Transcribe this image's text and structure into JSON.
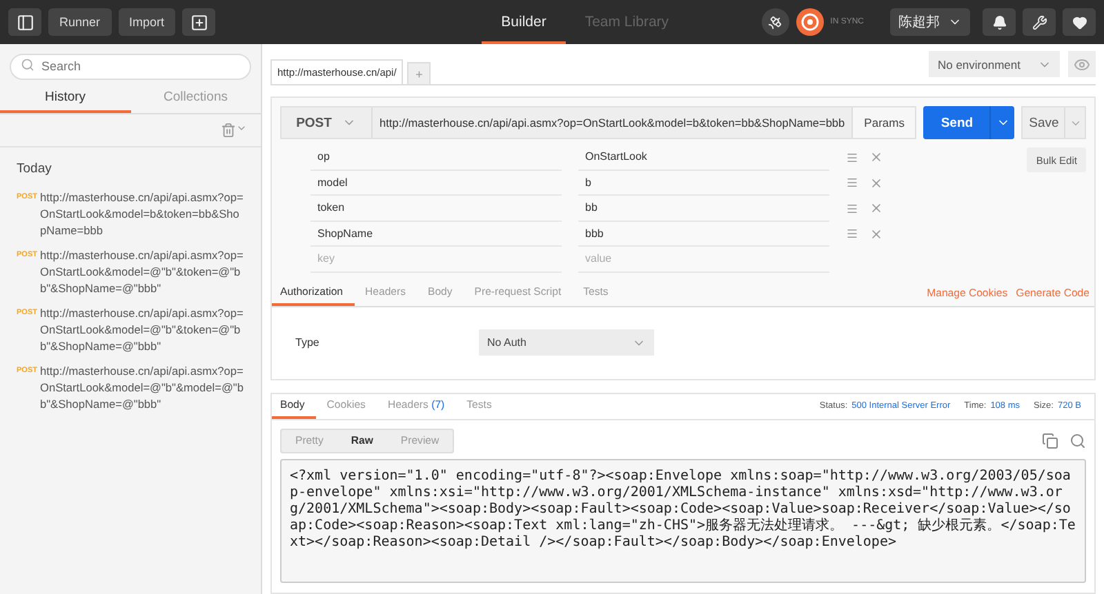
{
  "toolbar": {
    "buttons": [
      "Runner",
      "Import"
    ],
    "tabs": [
      {
        "label": "Builder",
        "selected": true
      },
      {
        "label": "Team Library",
        "selected": false
      }
    ],
    "sync": "IN SYNC",
    "user": "陈超邦"
  },
  "sidebar": {
    "search": {
      "placeholder": "Search"
    },
    "tabs": [
      {
        "label": "History",
        "selected": true
      },
      {
        "label": "Collections",
        "selected": false
      }
    ],
    "group": "Today",
    "items": [
      {
        "method": "POST",
        "url": "http://masterhouse.cn/api/api.asmx?op=OnStartLook&model=b&token=bb&ShopName=bbb"
      },
      {
        "method": "POST",
        "url": "http://masterhouse.cn/api/api.asmx?op=OnStartLook&model=@\"b\"&token=@\"bb\"&ShopName=@\"bbb\""
      },
      {
        "method": "POST",
        "url": "http://masterhouse.cn/api/api.asmx?op=OnStartLook&model=@\"b\"&token=@\"bb\"&ShopName=@\"bbb\""
      },
      {
        "method": "POST",
        "url": "http://masterhouse.cn/api/api.asmx?op=OnStartLook&model=@\"b\"&model=@\"bb\"&ShopName=@\"bbb\""
      }
    ]
  },
  "request_tabs": [
    {
      "label": "http://masterhouse.cn/api/",
      "selected": true
    }
  ],
  "new_tab": "+",
  "environment": "No environment",
  "request": {
    "method": "POST",
    "url": "http://masterhouse.cn/api/api.asmx?op=OnStartLook&model=b&token=bb&ShopName=bbb",
    "params_button": "Params",
    "send": "Send",
    "save": "Save",
    "params": [
      {
        "key": "op",
        "value": "OnStartLook"
      },
      {
        "key": "model",
        "value": "b"
      },
      {
        "key": "token",
        "value": "bb"
      },
      {
        "key": "ShopName",
        "value": "bbb"
      }
    ],
    "key_placeholder": "key",
    "value_placeholder": "value",
    "bulk_edit": "Bulk Edit",
    "tabs": [
      {
        "label": "Authorization",
        "selected": true
      },
      {
        "label": "Headers",
        "selected": false
      },
      {
        "label": "Body",
        "selected": false
      },
      {
        "label": "Pre-request Script",
        "selected": false
      },
      {
        "label": "Tests",
        "selected": false
      }
    ],
    "links": [
      "Manage Cookies",
      "Generate Code"
    ],
    "auth": {
      "label": "Type",
      "value": "No Auth"
    }
  },
  "response": {
    "tabs": [
      {
        "label": "Body",
        "selected": true
      },
      {
        "label": "Cookies",
        "selected": false
      },
      {
        "label": "Headers",
        "count": "(7)",
        "selected": false
      },
      {
        "label": "Tests",
        "selected": false
      }
    ],
    "stats": [
      {
        "label": "Status:",
        "value": "500 Internal Server Error"
      },
      {
        "label": "Time:",
        "value": "108 ms"
      },
      {
        "label": "Size:",
        "value": "720 B"
      }
    ],
    "views": [
      {
        "label": "Pretty",
        "selected": false
      },
      {
        "label": "Raw",
        "selected": true
      },
      {
        "label": "Preview",
        "selected": false
      }
    ],
    "body": "<?xml version=\"1.0\" encoding=\"utf-8\"?><soap:Envelope xmlns:soap=\"http://www.w3.org/2003/05/soap-envelope\" xmlns:xsi=\"http://www.w3.org/2001/XMLSchema-instance\" xmlns:xsd=\"http://www.w3.org/2001/XMLSchema\"><soap:Body><soap:Fault><soap:Code><soap:Value>soap:Receiver</soap:Value></soap:Code><soap:Reason><soap:Text xml:lang=\"zh-CHS\">服务器无法处理请求。 ---&gt; 缺少根元素。</soap:Text></soap:Reason><soap:Detail /></soap:Fault></soap:Body></soap:Envelope>"
  }
}
